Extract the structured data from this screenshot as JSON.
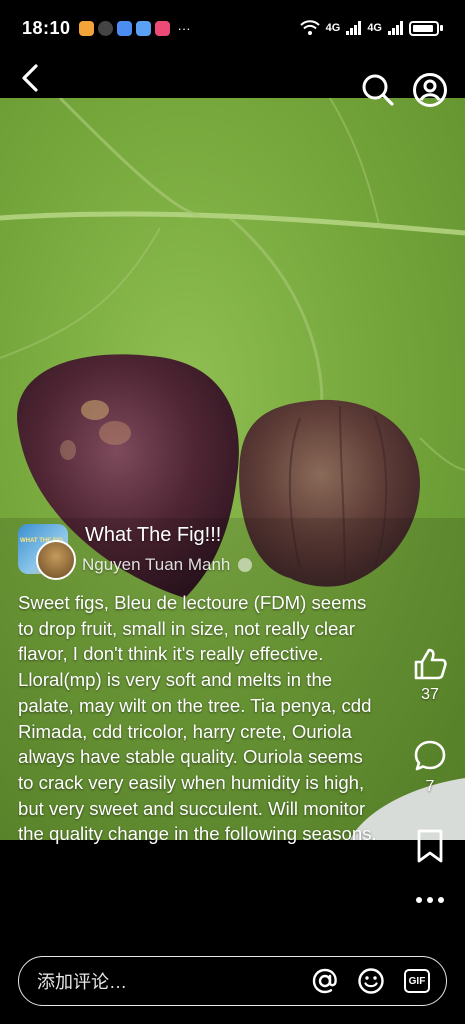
{
  "status_bar": {
    "time": "18:10",
    "network_label_1": "4G",
    "network_label_2": "4G",
    "more_indicator": "···"
  },
  "nav": {
    "back_icon": "chevron-left-icon",
    "search_icon": "search-icon",
    "profile_icon": "user-circle-icon"
  },
  "post": {
    "group_name": "What The Fig!!!",
    "author": "Nguyen Tuan Manh",
    "avatar_text": "WHAT THE FIG",
    "text": "Sweet figs, Bleu de lectoure (FDM) seems to drop fruit, small in size, not really clear flavor, I don't think it's really effective.  Lloral(mp) is very soft and melts in the palate, may wilt on the tree.  Tia penya, cdd Rimada, cdd tricolor, harry crete, Ouriola always have stable quality.  Ouriola seems to crack very easily when humidity is high, but very sweet and succulent.  Will monitor the quality change in the following seasons."
  },
  "actions": {
    "like_count": "37",
    "comment_count": "7",
    "like_icon": "thumbs-up-icon",
    "comment_icon": "comment-bubble-icon",
    "save_icon": "bookmark-icon",
    "more_icon": "more-dots-icon"
  },
  "comment_bar": {
    "placeholder": "添加评论…",
    "gif_label": "GIF"
  },
  "colors": {
    "background": "#000000",
    "leaf_green": "#77a83d",
    "fig_purple": "#5a2d3c",
    "text": "#ffffff"
  }
}
